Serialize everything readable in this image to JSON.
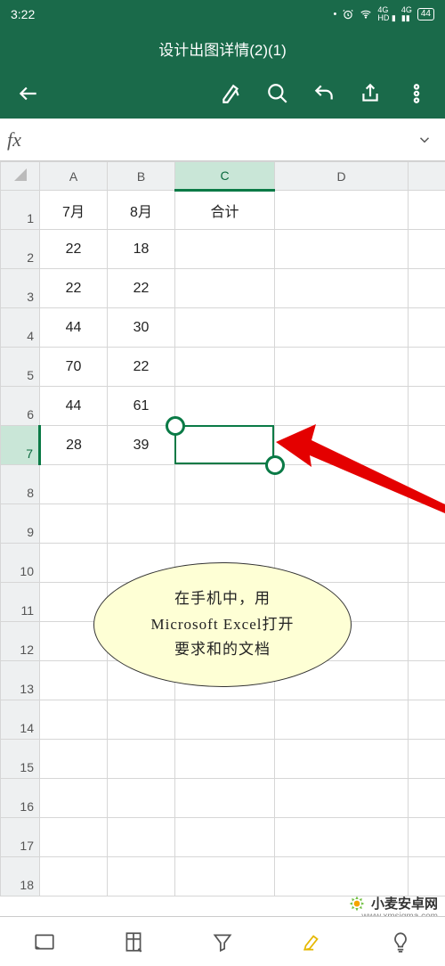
{
  "statusbar": {
    "time": "3:22",
    "battery": "44"
  },
  "header": {
    "title": "设计出图详情(2)(1)",
    "fx_label": "fx"
  },
  "columns": [
    "A",
    "B",
    "C",
    "D"
  ],
  "rows": [
    "1",
    "2",
    "3",
    "4",
    "5",
    "6",
    "7",
    "8",
    "9",
    "10",
    "11",
    "12",
    "13",
    "14",
    "15",
    "16",
    "17",
    "18"
  ],
  "chart_data": {
    "type": "table",
    "selected_cell": "C7",
    "cells": {
      "A1": "7月",
      "B1": "8月",
      "C1": "合计",
      "A2": "22",
      "B2": "18",
      "A3": "22",
      "B3": "22",
      "A4": "44",
      "B4": "30",
      "A5": "70",
      "B5": "22",
      "A6": "44",
      "B6": "61",
      "A7": "28",
      "B7": "39"
    }
  },
  "callout": {
    "line1": "在手机中，用",
    "line2": "Microsoft Excel打开",
    "line3": "要求和的文档"
  },
  "watermark": {
    "text": "小麦安卓网",
    "url": "www.xmsigma.com"
  }
}
